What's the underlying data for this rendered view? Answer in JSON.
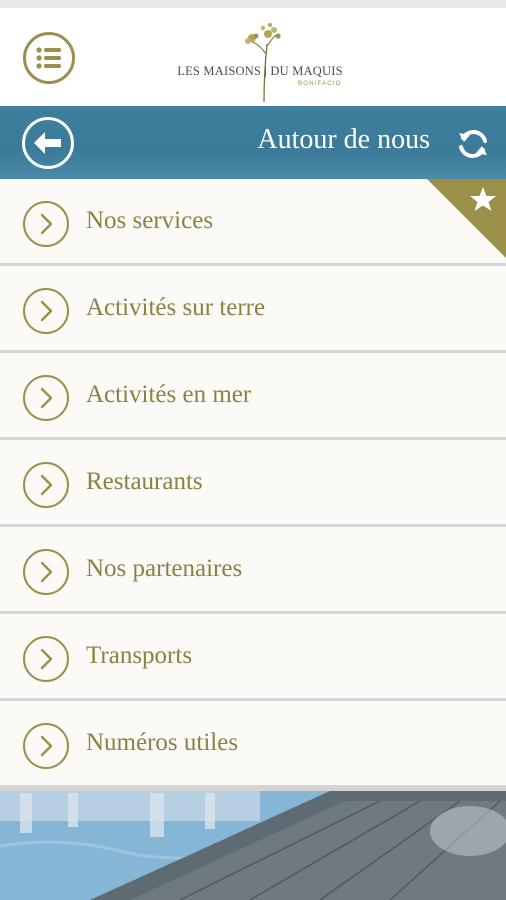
{
  "header": {
    "logo_text": "LES MAISONS | DU MAQUIS",
    "logo_subtext": "BONIFACIO",
    "menu_icon": "list-menu-icon",
    "accent_color": "#9c8f4a"
  },
  "titlebar": {
    "title": "Autour de nous",
    "back_icon": "arrow-left-icon",
    "refresh_icon": "refresh-icon",
    "background_color": "#3d7f9e"
  },
  "list": {
    "items": [
      {
        "label": "Nos services",
        "favorite": true
      },
      {
        "label": "Activités sur terre"
      },
      {
        "label": "Activités en mer"
      },
      {
        "label": "Restaurants"
      },
      {
        "label": "Nos partenaires"
      },
      {
        "label": "Transports"
      },
      {
        "label": "Numéros utiles"
      }
    ],
    "item_icon": "chevron-right-icon",
    "favorite_icon": "star-icon"
  }
}
